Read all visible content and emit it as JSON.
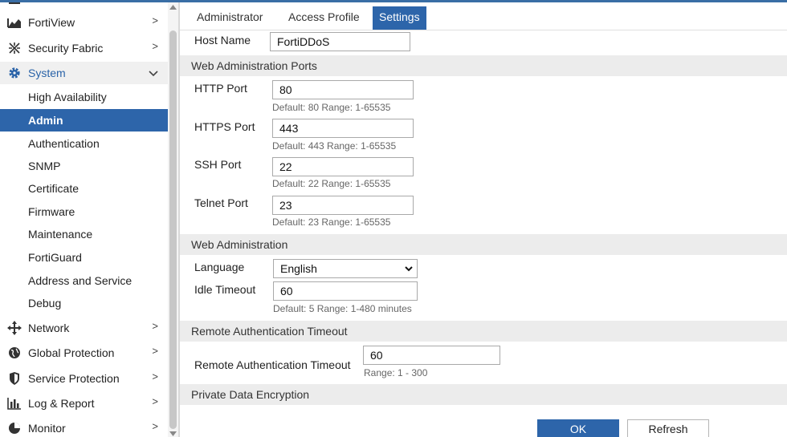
{
  "sidebar": {
    "items": [
      {
        "label": "FortiView",
        "icon": "chart-icon"
      },
      {
        "label": "Security Fabric",
        "icon": "fabric-icon"
      },
      {
        "label": "System",
        "icon": "gear-icon"
      },
      {
        "label": "High Availability"
      },
      {
        "label": "Admin"
      },
      {
        "label": "Authentication"
      },
      {
        "label": "SNMP"
      },
      {
        "label": "Certificate"
      },
      {
        "label": "Firmware"
      },
      {
        "label": "Maintenance"
      },
      {
        "label": "FortiGuard"
      },
      {
        "label": "Address and Service"
      },
      {
        "label": "Debug"
      },
      {
        "label": "Network",
        "icon": "network-arrows-icon"
      },
      {
        "label": "Global Protection",
        "icon": "globe-icon"
      },
      {
        "label": "Service Protection",
        "icon": "shield-icon"
      },
      {
        "label": "Log & Report",
        "icon": "bar-chart-icon"
      },
      {
        "label": "Monitor",
        "icon": "pie-chart-icon"
      }
    ]
  },
  "tabs": [
    {
      "label": "Administrator"
    },
    {
      "label": "Access Profile"
    },
    {
      "label": "Settings"
    }
  ],
  "form": {
    "host_name": {
      "label": "Host Name",
      "value": "FortiDDoS"
    },
    "web_admin_ports": {
      "title": "Web Administration Ports",
      "http": {
        "label": "HTTP Port",
        "value": "80",
        "hint": "Default: 80 Range: 1-65535"
      },
      "https": {
        "label": "HTTPS Port",
        "value": "443",
        "hint": "Default: 443 Range: 1-65535"
      },
      "ssh": {
        "label": "SSH Port",
        "value": "22",
        "hint": "Default: 22 Range: 1-65535"
      },
      "telnet": {
        "label": "Telnet Port",
        "value": "23",
        "hint": "Default: 23 Range: 1-65535"
      }
    },
    "web_admin": {
      "title": "Web Administration",
      "language": {
        "label": "Language",
        "value": "English"
      },
      "idle_timeout": {
        "label": "Idle Timeout",
        "value": "60",
        "hint": "Default: 5 Range: 1-480 minutes"
      }
    },
    "remote_auth": {
      "title": "Remote Authentication Timeout",
      "timeout": {
        "label": "Remote Authentication Timeout",
        "value": "60",
        "hint": "Range: 1 - 300"
      }
    },
    "private_data": {
      "title": "Private Data Encryption"
    }
  },
  "buttons": {
    "ok": "OK",
    "refresh": "Refresh"
  },
  "colors": {
    "accent": "#2d65aa",
    "section_bg": "#ececec"
  }
}
